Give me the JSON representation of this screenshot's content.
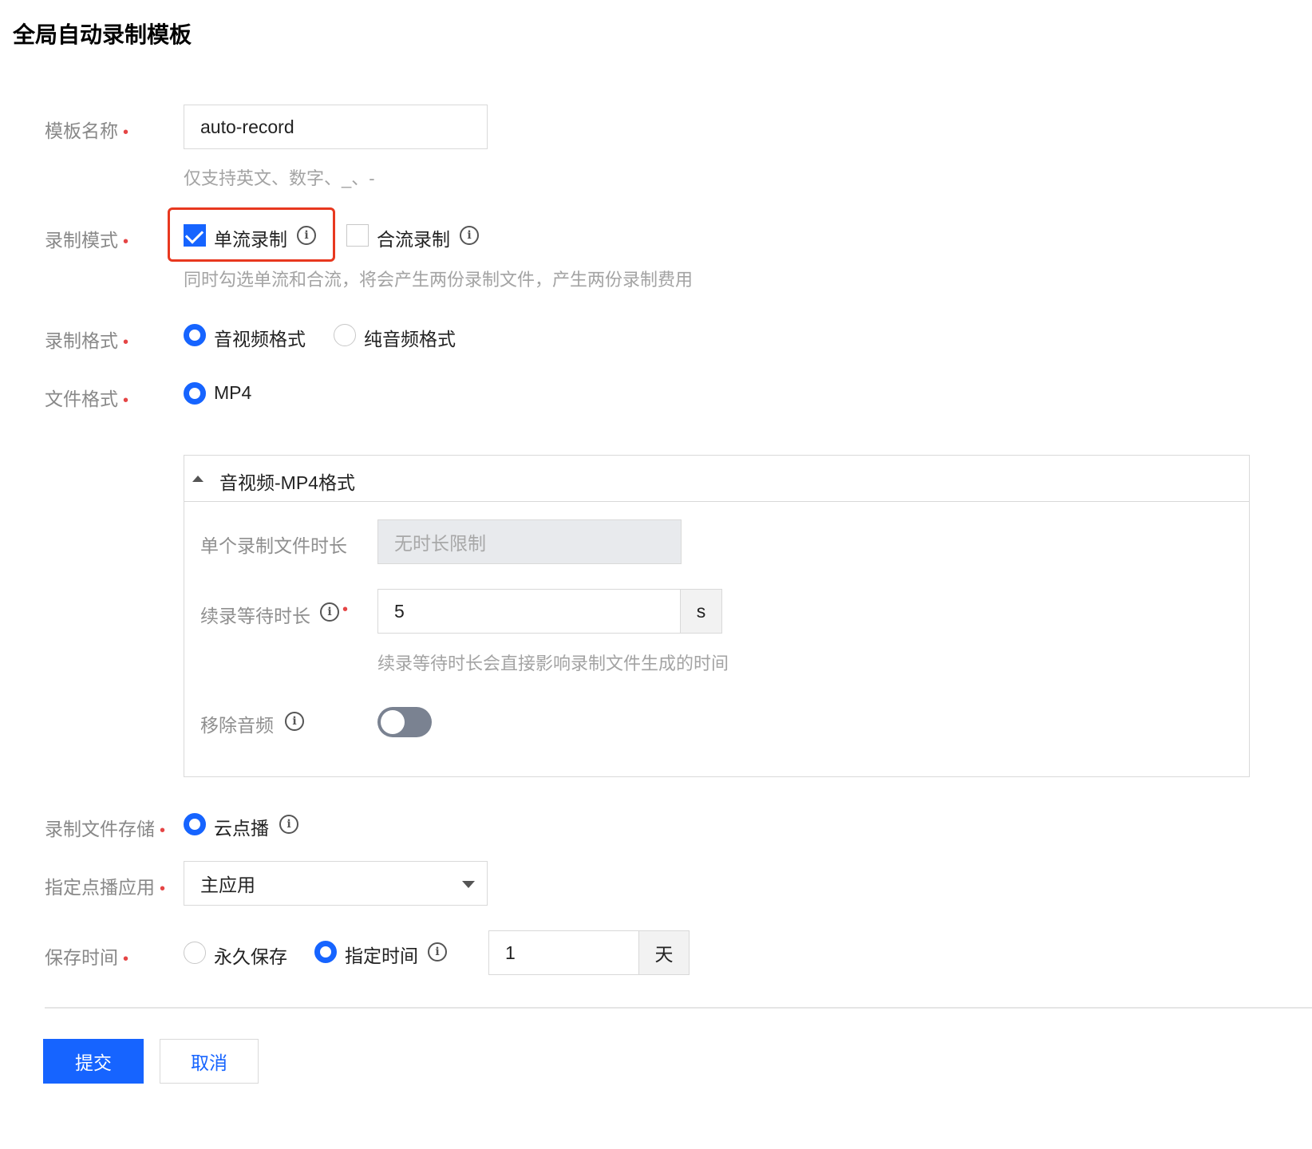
{
  "page": {
    "title": "全局自动录制模板"
  },
  "form": {
    "template_name": {
      "label": "模板名称",
      "required_mark": "•",
      "value": "auto-record",
      "help": "仅支持英文、数字、_、-"
    },
    "record_mode": {
      "label": "录制模式",
      "required_mark": "•",
      "options": [
        {
          "label": "单流录制",
          "checked": true
        },
        {
          "label": "合流录制",
          "checked": false
        }
      ],
      "help": "同时勾选单流和合流，将会产生两份录制文件，产生两份录制费用"
    },
    "record_format": {
      "label": "录制格式",
      "required_mark": "•",
      "options": [
        {
          "label": "音视频格式",
          "selected": true
        },
        {
          "label": "纯音频格式",
          "selected": false
        }
      ]
    },
    "file_format": {
      "label": "文件格式",
      "required_mark": "•",
      "options": [
        {
          "label": "MP4",
          "selected": true
        }
      ]
    },
    "mp4_panel": {
      "title": "音视频-MP4格式",
      "expanded": true,
      "single_file_duration": {
        "label": "单个录制文件时长",
        "value": "无时长限制",
        "disabled": true
      },
      "resume_wait": {
        "label": "续录等待时长",
        "required_mark": "•",
        "value": "5",
        "unit": "s",
        "help": "续录等待时长会直接影响录制文件生成的时间"
      },
      "remove_audio": {
        "label": "移除音频",
        "on": false
      }
    },
    "storage": {
      "label": "录制文件存储",
      "required_mark": "•",
      "options": [
        {
          "label": "云点播",
          "selected": true
        }
      ]
    },
    "vod_app": {
      "label": "指定点播应用",
      "required_mark": "•",
      "value": "主应用"
    },
    "retention": {
      "label": "保存时间",
      "required_mark": "•",
      "options": [
        {
          "label": "永久保存",
          "selected": false
        },
        {
          "label": "指定时间",
          "selected": true
        }
      ],
      "value": "1",
      "unit": "天"
    }
  },
  "actions": {
    "submit_label": "提交",
    "cancel_label": "取消"
  },
  "colors": {
    "primary": "#1664ff",
    "highlight": "#e8381f",
    "required": "#e54545"
  }
}
